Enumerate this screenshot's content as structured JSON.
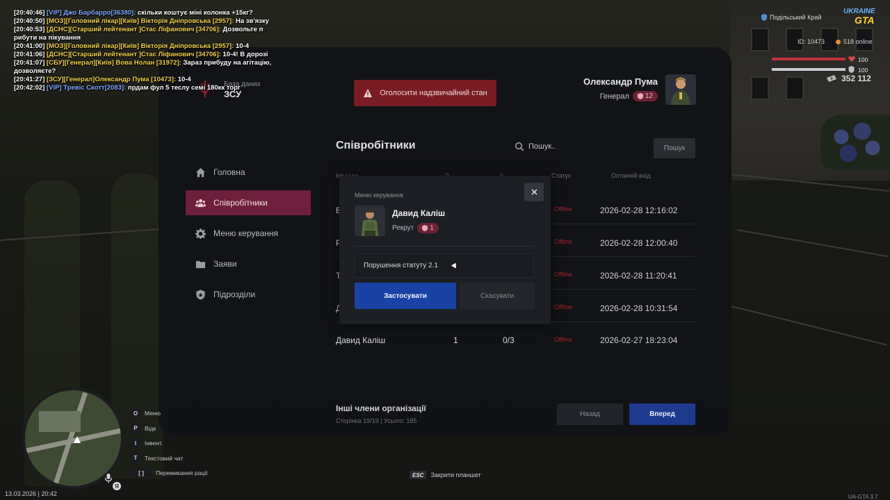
{
  "chat": [
    {
      "time": "[20:40:46]",
      "tag": "[VIP] Джо Барбарро[36380]:",
      "tag_color": "vip",
      "text": "скільки коштує міні колонка +15кг?"
    },
    {
      "time": "[20:40:50]",
      "tag": "[МОЗ][Головний лікар][Київ] Вікторія Дніпровська [2957]:",
      "tag_color": "org",
      "text": "На зв'язку"
    },
    {
      "time": "[20:40:53]",
      "tag": "[ДСНС][Старший лейтенант ]Стас Ліфанович [34706]:",
      "tag_color": "org",
      "text": "Дозвольте п рибути на пікування"
    },
    {
      "time": "[20:41:00]",
      "tag": "[МОЗ][Головний лікар][Київ] Вікторія Дніпровська [2957]:",
      "tag_color": "org",
      "text": "10-4"
    },
    {
      "time": "[20:41:06]",
      "tag": "[ДСНС][Старший лейтенант ]Стас Ліфанович [34706]:",
      "tag_color": "org",
      "text": "10-4! В дорозі"
    },
    {
      "time": "[20:41:07]",
      "tag": "[СБУ][Генерал][Київ] Вова Нолан [31972]:",
      "tag_color": "org",
      "text": "Зараз прибуду на агітацію, дозволяєте?"
    },
    {
      "time": "[20:41:27]",
      "tag": "[ЗСУ][Генерал]Олександр Пума [10473]:",
      "tag_color": "org",
      "text": "10-4"
    },
    {
      "time": "[20:42:02]",
      "tag": "[VIP] Тревіс Скотт[2083]:",
      "tag_color": "vip",
      "text": "прдам фул 5 теслу семі 180кк торг"
    }
  ],
  "hud": {
    "region": "Подільський Край",
    "logo_line1": "UKRAINE",
    "logo_line2": "GTA",
    "player_id": "ID: 10473",
    "online": "518 online",
    "health": "100",
    "health_value": 1.0,
    "armor": "100",
    "armor_value": 1.0,
    "money": "352 112",
    "datetime": "13.03.2026 | 20:42",
    "version": "UA-GTA 3.7",
    "ya": "Я",
    "hotkeys": [
      {
        "key": "O",
        "label": "Меню"
      },
      {
        "key": "P",
        "label": "Відк"
      },
      {
        "key": "I",
        "label": "Інвент."
      },
      {
        "key": "T",
        "label": "Текстовий чат"
      },
      {
        "key": "[  ]",
        "label": "Перемикання рації"
      }
    ],
    "esc_key": "ESC",
    "esc_label": "Закрити планшет"
  },
  "tablet": {
    "db_label": "База даних",
    "org_name": "ЗСУ",
    "emergency_label": "Оголосити надзвичайний стан",
    "user": {
      "name": "Олександр Пума",
      "rank": "Генерал",
      "rank_level": "12"
    },
    "nav": [
      {
        "label": "Головна",
        "icon": "home-icon",
        "active": false
      },
      {
        "label": "Співробітники",
        "icon": "users-icon",
        "active": true
      },
      {
        "label": "Меню керування",
        "icon": "gear-icon",
        "active": false
      },
      {
        "label": "Заяви",
        "icon": "folder-icon",
        "active": false
      },
      {
        "label": "Підрозділи",
        "icon": "shield-icon",
        "active": false
      }
    ],
    "section_title": "Співробітники",
    "search_placeholder": "Пошук..",
    "search_button": "Пошук",
    "headers": {
      "name": "Ініціали",
      "col2": "Р",
      "col3": "З",
      "status": "Статус",
      "last_login": "Останній вхід"
    },
    "rows": [
      {
        "name": "В",
        "rank": "",
        "warns": "",
        "status": "Offline",
        "last_login": "2026-02-28 12:16:02"
      },
      {
        "name": "Р",
        "rank": "",
        "warns": "",
        "status": "Offline",
        "last_login": "2026-02-28 12:00:40"
      },
      {
        "name": "Т",
        "rank": "",
        "warns": "",
        "status": "Offline",
        "last_login": "2026-02-28 11:20:41"
      },
      {
        "name": "Д",
        "rank": "",
        "warns": "",
        "status": "Offline",
        "last_login": "2026-02-28 10:31:54"
      },
      {
        "name": "Давид Каліш",
        "rank": "1",
        "warns": "0/3",
        "status": "Offline",
        "last_login": "2026-02-27 18:23:04"
      }
    ],
    "others_title": "Інші члени організації",
    "page_info": "Сторінка 19/19 | Усього: 185",
    "prev_label": "Назад",
    "next_label": "Вперед"
  },
  "modal": {
    "title": "Меню керування",
    "member_name": "Давид Каліш",
    "member_rank": "Рекрут",
    "member_level": "1",
    "reason_value": "Порушення статуту 2.1",
    "apply_label": "Застосувати",
    "cancel_label": "Скасувати"
  },
  "colors": {
    "accent_active": "#6e1f3b",
    "primary_blue": "#1d3a8f",
    "emergency_red": "#7a1d22",
    "offline_red": "#a8242c"
  }
}
